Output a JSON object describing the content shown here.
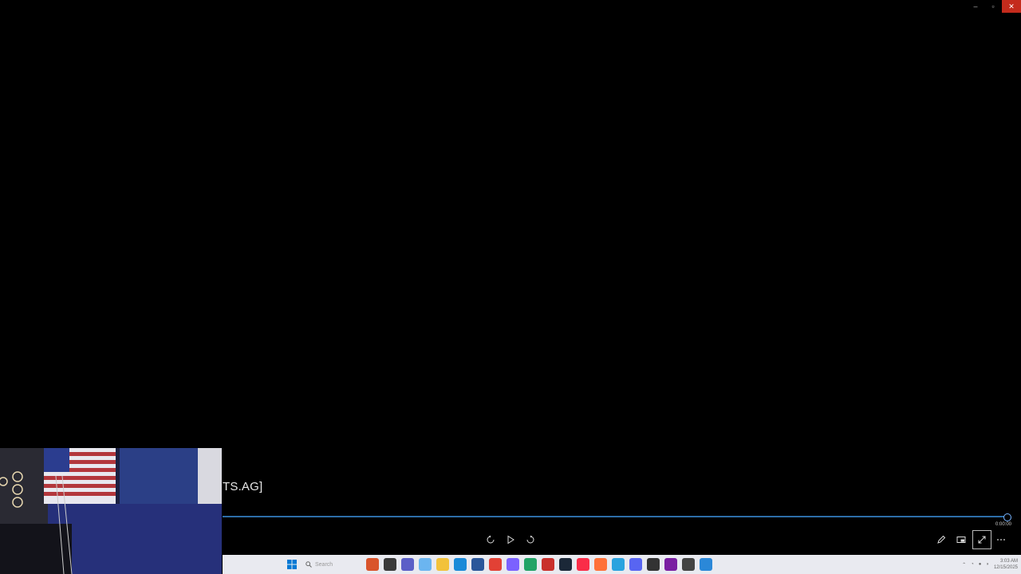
{
  "player": {
    "title_fragment": "TS.AG]",
    "current_time": "0:00:00",
    "progress": 1.0
  },
  "window": {
    "minimize": "–",
    "restore": "▫",
    "close": "✕"
  },
  "taskbar": {
    "search_placeholder": "Search",
    "clock_time": "3:03 AM",
    "clock_date": "12/15/2025",
    "accent": "#0078d4"
  },
  "colors": {
    "seek_bar": "#2d6ea8",
    "close_button": "#c42b1c",
    "background": "#000000"
  }
}
